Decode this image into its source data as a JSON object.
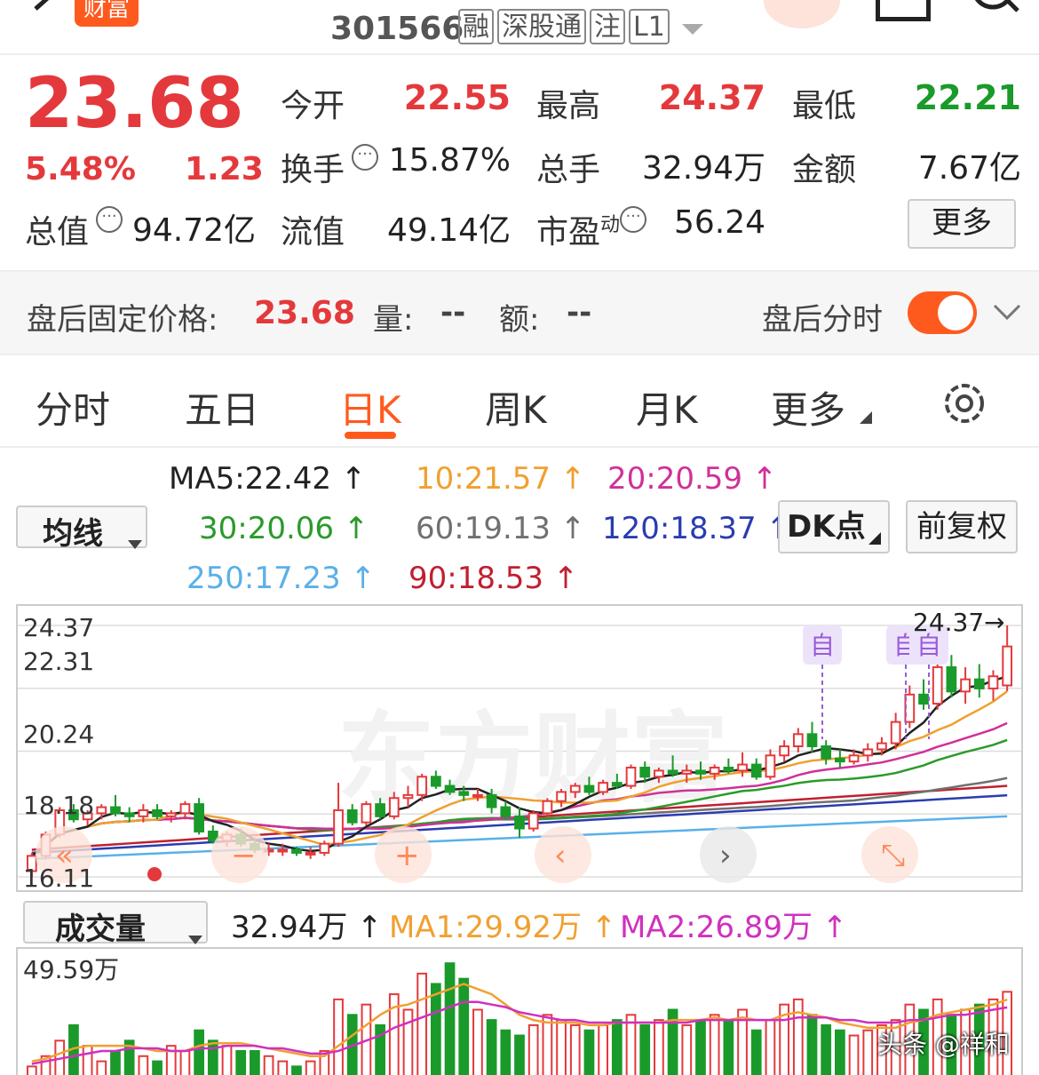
{
  "header": {
    "logo_text": "财富",
    "code": "301566",
    "tags": [
      "融",
      "深股通",
      "注",
      "L1"
    ]
  },
  "quote": {
    "price": "23.68",
    "change_pct": "5.48%",
    "change": "1.23",
    "rows": [
      [
        {
          "label": "今开",
          "value": "22.55",
          "color": "red"
        },
        {
          "label": "最高",
          "value": "24.37",
          "color": "red"
        },
        {
          "label": "最低",
          "value": "22.21",
          "color": "green"
        }
      ],
      [
        {
          "label": "换手",
          "value": "15.87%",
          "color": "dark"
        },
        {
          "label": "总手",
          "value": "32.94万",
          "color": "dark"
        },
        {
          "label": "金额",
          "value": "7.67亿",
          "color": "dark"
        }
      ],
      [
        {
          "label": "总值",
          "value": "94.72亿",
          "color": "dark"
        },
        {
          "label": "流值",
          "value": "49.14亿",
          "color": "dark"
        },
        {
          "label": "市盈",
          "value": "56.24",
          "color": "dark"
        }
      ]
    ],
    "pe_sup": "动",
    "more_button": "更多"
  },
  "after_hours": {
    "label": "盘后固定价格:",
    "price": "23.68",
    "vol_label": "量:",
    "vol_value": "--",
    "amount_label": "额:",
    "amount_value": "--",
    "toggle_label": "盘后分时",
    "toggle_on": true
  },
  "tabs": [
    {
      "label": "分时",
      "active": false
    },
    {
      "label": "五日",
      "active": false
    },
    {
      "label": "日K",
      "active": true
    },
    {
      "label": "周K",
      "active": false
    },
    {
      "label": "月K",
      "active": false
    },
    {
      "label": "更多",
      "active": false
    }
  ],
  "ma_panel": {
    "selector": "均线",
    "lines": [
      {
        "text": "MA5:22.42",
        "color": "#222222"
      },
      {
        "text": "10:21.57",
        "color": "#f0a030"
      },
      {
        "text": "20:20.59",
        "color": "#d0309a"
      },
      {
        "text": "30:20.06",
        "color": "#2a9a2a"
      },
      {
        "text": "60:19.13",
        "color": "#707070"
      },
      {
        "text": "120:18.37",
        "color": "#2a3cb0"
      },
      {
        "text": "250:17.23",
        "color": "#5ab0e8"
      },
      {
        "text": "90:18.53",
        "color": "#c02030"
      }
    ],
    "dk_button": "DK点",
    "adjust_button": "前复权"
  },
  "kline": {
    "y_labels": [
      "24.37",
      "22.31",
      "20.24",
      "18.18",
      "16.11"
    ],
    "high_marker": "24.37→",
    "marker_text": "自",
    "watermark": "东方财富",
    "chart_data": {
      "type": "candlestick",
      "ylim": [
        16.11,
        24.37
      ],
      "candles": [
        [
          16.3,
          16.9,
          16.1,
          16.8
        ],
        [
          16.8,
          17.6,
          16.7,
          17.5
        ],
        [
          17.5,
          18.4,
          17.4,
          18.3
        ],
        [
          18.3,
          18.5,
          17.9,
          18.0
        ],
        [
          18.0,
          18.3,
          17.8,
          18.2
        ],
        [
          18.2,
          18.5,
          18.0,
          18.4
        ],
        [
          18.4,
          18.8,
          18.1,
          18.2
        ],
        [
          18.2,
          18.4,
          17.9,
          18.1
        ],
        [
          18.1,
          18.5,
          17.9,
          18.3
        ],
        [
          18.3,
          18.5,
          18.0,
          18.1
        ],
        [
          18.1,
          18.3,
          17.9,
          18.2
        ],
        [
          18.2,
          18.6,
          18.0,
          18.5
        ],
        [
          18.5,
          18.7,
          17.5,
          17.6
        ],
        [
          17.6,
          17.8,
          17.2,
          17.3
        ],
        [
          17.3,
          17.6,
          17.1,
          17.5
        ],
        [
          17.5,
          17.7,
          17.1,
          17.2
        ],
        [
          17.2,
          17.4,
          16.9,
          17.0
        ],
        [
          17.0,
          17.2,
          16.8,
          17.0
        ],
        [
          17.0,
          17.2,
          16.8,
          17.0
        ],
        [
          17.0,
          17.1,
          16.8,
          16.9
        ],
        [
          16.9,
          17.1,
          16.7,
          16.9
        ],
        [
          16.9,
          17.3,
          16.8,
          17.2
        ],
        [
          17.2,
          19.2,
          17.1,
          18.3
        ],
        [
          18.3,
          18.5,
          17.8,
          17.9
        ],
        [
          17.9,
          18.6,
          17.8,
          18.5
        ],
        [
          18.5,
          18.7,
          18.0,
          18.1
        ],
        [
          18.1,
          18.9,
          18.0,
          18.7
        ],
        [
          18.7,
          19.1,
          18.4,
          18.8
        ],
        [
          18.8,
          19.5,
          18.6,
          19.4
        ],
        [
          19.4,
          19.6,
          19.0,
          19.1
        ],
        [
          19.1,
          19.3,
          18.8,
          18.9
        ],
        [
          18.9,
          19.1,
          18.6,
          18.8
        ],
        [
          18.8,
          19.0,
          18.6,
          18.8
        ],
        [
          18.8,
          19.0,
          18.2,
          18.4
        ],
        [
          18.4,
          18.6,
          18.0,
          18.1
        ],
        [
          18.1,
          18.4,
          17.4,
          17.7
        ],
        [
          17.7,
          18.3,
          17.6,
          18.2
        ],
        [
          18.2,
          18.7,
          18.1,
          18.6
        ],
        [
          18.6,
          19.0,
          18.4,
          18.9
        ],
        [
          18.9,
          19.2,
          18.7,
          19.1
        ],
        [
          19.1,
          19.4,
          18.8,
          18.9
        ],
        [
          18.9,
          19.3,
          18.8,
          19.2
        ],
        [
          19.2,
          19.5,
          19.0,
          19.1
        ],
        [
          19.1,
          19.8,
          19.0,
          19.7
        ],
        [
          19.7,
          19.9,
          19.2,
          19.4
        ],
        [
          19.4,
          19.7,
          19.2,
          19.6
        ],
        [
          19.6,
          20.1,
          19.4,
          19.5
        ],
        [
          19.5,
          19.8,
          19.2,
          19.6
        ],
        [
          19.6,
          19.9,
          19.3,
          19.5
        ],
        [
          19.5,
          19.8,
          19.3,
          19.7
        ],
        [
          19.7,
          20.0,
          19.5,
          19.6
        ],
        [
          19.6,
          20.2,
          19.4,
          19.8
        ],
        [
          19.8,
          20.0,
          19.3,
          19.4
        ],
        [
          19.4,
          20.3,
          19.3,
          20.1
        ],
        [
          20.1,
          20.6,
          19.9,
          20.4
        ],
        [
          20.4,
          21.0,
          20.2,
          20.8
        ],
        [
          20.8,
          21.2,
          20.2,
          20.4
        ],
        [
          20.4,
          20.6,
          19.8,
          20.0
        ],
        [
          20.0,
          20.3,
          19.7,
          19.9
        ],
        [
          19.9,
          20.3,
          19.8,
          20.1
        ],
        [
          20.1,
          20.5,
          19.9,
          20.3
        ],
        [
          20.3,
          20.7,
          20.1,
          20.5
        ],
        [
          20.5,
          21.5,
          20.3,
          21.2
        ],
        [
          21.2,
          22.4,
          21.0,
          22.1
        ],
        [
          22.1,
          22.6,
          21.6,
          21.8
        ],
        [
          21.8,
          23.6,
          21.6,
          23.0
        ],
        [
          23.0,
          23.4,
          22.0,
          22.2
        ],
        [
          22.2,
          23.0,
          21.8,
          22.6
        ],
        [
          22.6,
          23.1,
          22.0,
          22.3
        ],
        [
          22.3,
          22.9,
          21.9,
          22.7
        ],
        [
          22.4,
          24.37,
          22.21,
          23.68
        ]
      ]
    }
  },
  "volume": {
    "selector": "成交量",
    "current": "32.94万",
    "ma1": "MA1:29.92万",
    "ma2": "MA2:26.89万",
    "y_max_label": "49.59万",
    "source_mark": "头条 @祥和",
    "chart_data": {
      "type": "bar",
      "ylim": [
        0,
        49.59
      ],
      "values": [
        4,
        8,
        14,
        20,
        12,
        6,
        10,
        14,
        8,
        6,
        12,
        10,
        18,
        14,
        12,
        10,
        10,
        8,
        6,
        4,
        6,
        10,
        30,
        24,
        28,
        20,
        32,
        26,
        40,
        36,
        44,
        38,
        26,
        22,
        18,
        16,
        20,
        24,
        22,
        20,
        18,
        20,
        22,
        24,
        20,
        22,
        26,
        20,
        22,
        24,
        22,
        26,
        18,
        22,
        28,
        30,
        24,
        20,
        18,
        16,
        18,
        20,
        22,
        28,
        26,
        30,
        24,
        26,
        28,
        30,
        32.94
      ],
      "ma1": [
        6,
        7,
        9,
        11,
        12,
        12,
        12,
        12,
        11,
        10,
        10,
        10,
        12,
        13,
        13,
        13,
        12,
        11,
        10,
        9,
        8,
        8,
        12,
        16,
        20,
        24,
        27,
        28,
        30,
        32,
        34,
        36,
        34,
        32,
        28,
        24,
        22,
        21,
        21,
        21,
        20,
        20,
        21,
        21,
        21,
        21,
        22,
        22,
        22,
        23,
        22,
        23,
        22,
        22,
        24,
        25,
        24,
        23,
        21,
        20,
        19,
        19,
        19,
        21,
        22,
        24,
        25,
        26,
        27,
        28,
        29.92
      ],
      "ma2": [
        5,
        6,
        7,
        8,
        9,
        10,
        10,
        11,
        11,
        11,
        10,
        10,
        11,
        11,
        12,
        12,
        12,
        11,
        11,
        10,
        9,
        9,
        10,
        12,
        14,
        16,
        19,
        21,
        23,
        25,
        27,
        29,
        29,
        28,
        27,
        25,
        24,
        23,
        22,
        22,
        21,
        21,
        21,
        21,
        21,
        21,
        21,
        21,
        22,
        22,
        22,
        22,
        22,
        22,
        22,
        23,
        23,
        23,
        22,
        22,
        21,
        21,
        21,
        22,
        22,
        23,
        24,
        24,
        25,
        26,
        26.89
      ]
    }
  }
}
